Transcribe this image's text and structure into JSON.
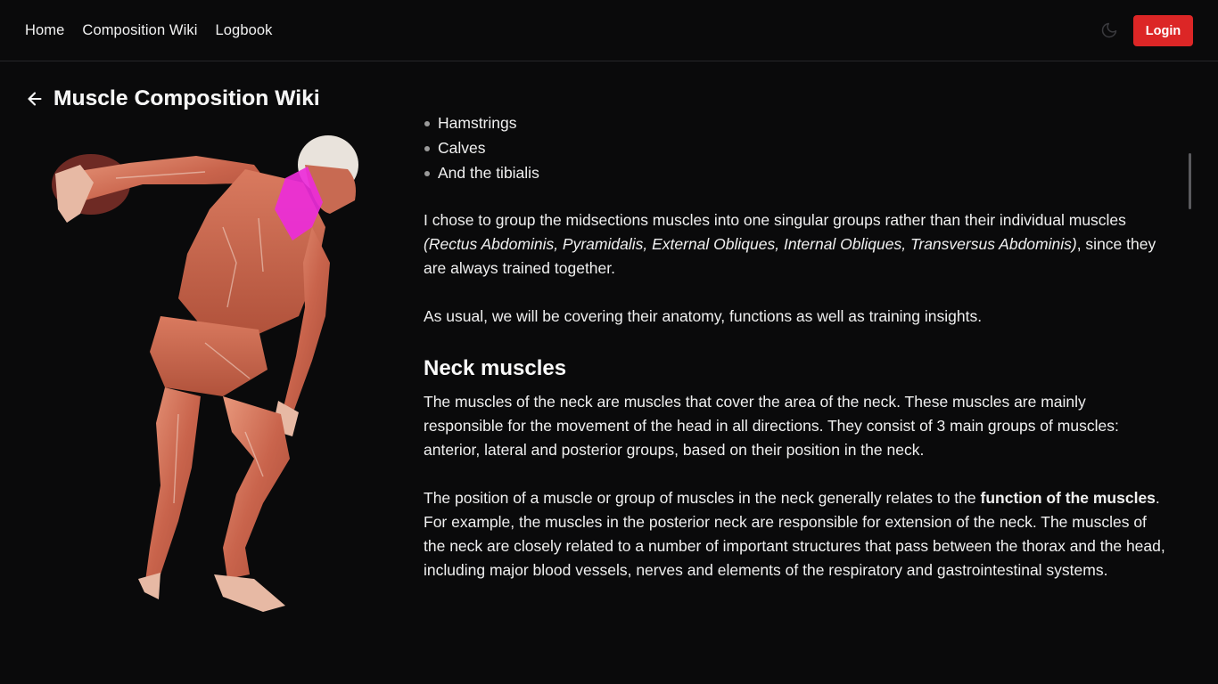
{
  "nav": {
    "links": [
      "Home",
      "Composition Wiki",
      "Logbook"
    ],
    "login_label": "Login",
    "theme_icon": "moon-icon"
  },
  "header": {
    "back_icon": "arrow-left-icon",
    "title": "Muscle Composition Wiki"
  },
  "figure": {
    "highlighted_muscle": "neck",
    "highlight_color": "#ec2cd9"
  },
  "content": {
    "bullets": [
      "Hamstrings",
      "Calves",
      "And the tibialis"
    ],
    "intro_p1_start": "I chose to group the midsections muscles into one singular groups rather than their individual muscles ",
    "intro_p1_italic": "(Rectus Abdominis, Pyramidalis, External Obliques, Internal Obliques, Transversus Abdominis)",
    "intro_p1_end": ", since they are always trained together.",
    "intro_p2": "As usual, we will be covering their anatomy, functions as well as training insights.",
    "section_title": "Neck muscles",
    "neck_p1": "The muscles of the neck are muscles that cover the area of the neck. These muscles are mainly responsible for the movement of the head in all directions. They consist of 3 main groups of muscles: anterior, lateral and posterior groups, based on their position in the neck.",
    "neck_p2_start": "The position of a muscle or group of muscles in the neck generally relates to the ",
    "neck_p2_bold": "function of the muscles",
    "neck_p2_end": ". For example, the muscles in the posterior neck are responsible for extension of the neck. The muscles of the neck are closely related to a number of important structures that pass between the thorax and the head, including major blood vessels, nerves and elements of the respiratory and gastrointestinal systems."
  },
  "colors": {
    "background": "#0a0a0b",
    "accent": "#dc2626",
    "highlight": "#ec2cd9"
  }
}
